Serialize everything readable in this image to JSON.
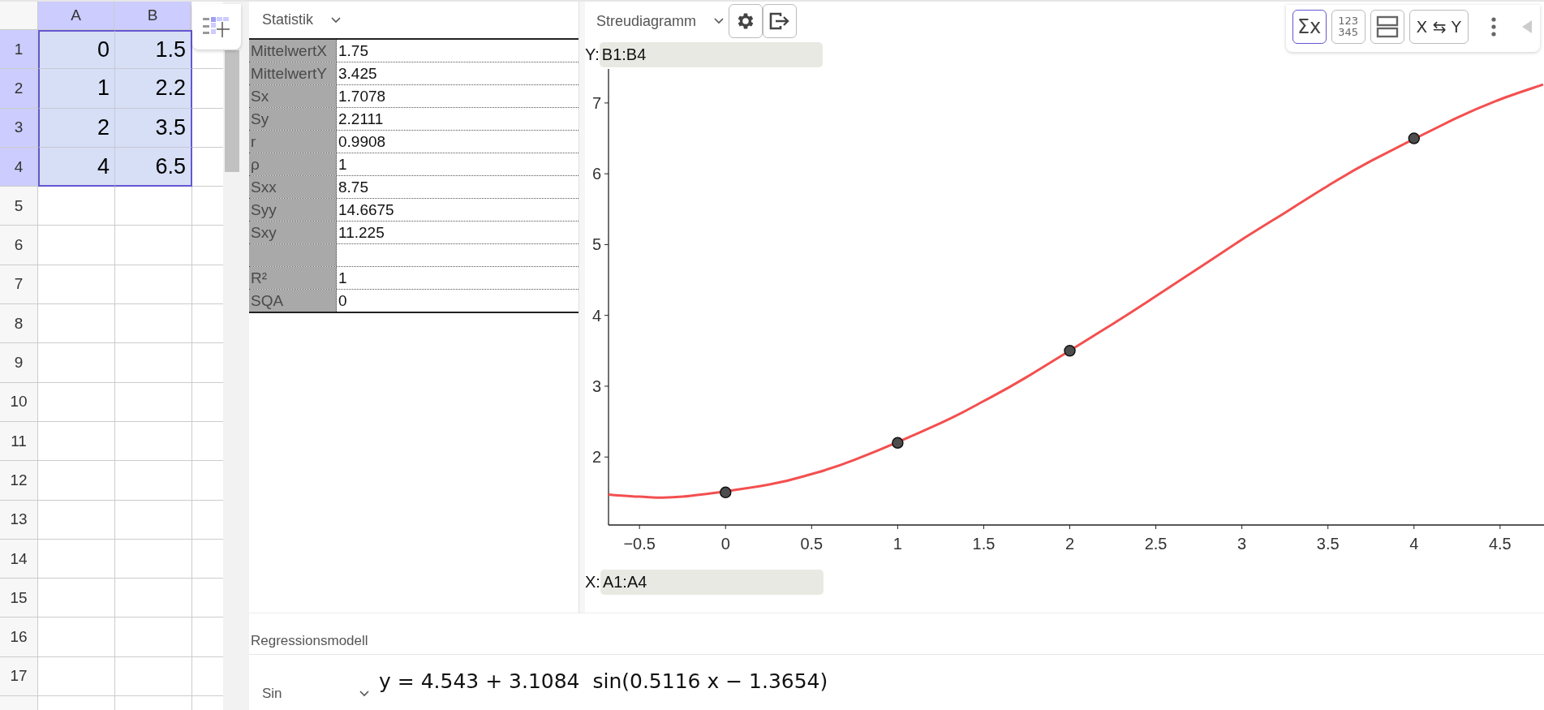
{
  "spreadsheet": {
    "columns": [
      {
        "label": "A",
        "selected": true
      },
      {
        "label": "B",
        "selected": true
      }
    ],
    "rows": [
      {
        "label": "1",
        "selected": true,
        "cells": [
          "0",
          "1.5"
        ]
      },
      {
        "label": "2",
        "selected": true,
        "cells": [
          "1",
          "2.2"
        ]
      },
      {
        "label": "3",
        "selected": true,
        "cells": [
          "2",
          "3.5"
        ]
      },
      {
        "label": "4",
        "selected": true,
        "cells": [
          "4",
          "6.5"
        ]
      },
      {
        "label": "5",
        "selected": false
      },
      {
        "label": "6",
        "selected": false
      },
      {
        "label": "7",
        "selected": false
      },
      {
        "label": "8",
        "selected": false
      },
      {
        "label": "9",
        "selected": false
      },
      {
        "label": "10",
        "selected": false
      },
      {
        "label": "11",
        "selected": false
      },
      {
        "label": "12",
        "selected": false
      },
      {
        "label": "13",
        "selected": false
      },
      {
        "label": "14",
        "selected": false
      },
      {
        "label": "15",
        "selected": false
      },
      {
        "label": "16",
        "selected": false
      },
      {
        "label": "17",
        "selected": false
      }
    ]
  },
  "statistics": {
    "dropdown": "Statistik",
    "rows": [
      {
        "kind": "stat",
        "label": "MittelwertX",
        "value": "1.75"
      },
      {
        "kind": "stat",
        "label": "MittelwertY",
        "value": "3.425"
      },
      {
        "kind": "stat",
        "label": "Sx",
        "value": "1.7078"
      },
      {
        "kind": "stat",
        "label": "Sy",
        "value": "2.2111"
      },
      {
        "kind": "stat",
        "label": "r",
        "value": "0.9908"
      },
      {
        "kind": "stat",
        "label": "ρ",
        "value": "1"
      },
      {
        "kind": "stat",
        "label": "Sxx",
        "value": "8.75"
      },
      {
        "kind": "stat",
        "label": "Syy",
        "value": "14.6675"
      },
      {
        "kind": "stat",
        "label": "Sxy",
        "value": "11.225"
      },
      {
        "kind": "blank"
      },
      {
        "kind": "stat",
        "label": "R²",
        "value": "1"
      },
      {
        "kind": "stat",
        "label": "SQA",
        "value": "0"
      }
    ]
  },
  "plot": {
    "dropdown": "Streudiagramm",
    "y_field": {
      "label": "Y:",
      "value": "B1:B4"
    },
    "x_field": {
      "label": "X:",
      "value": "A1:A4"
    },
    "toolbar": [
      {
        "kind": "sum",
        "label": "Σx",
        "selected": true
      },
      {
        "kind": "digits",
        "lines": [
          "123",
          "345"
        ],
        "selected": false
      },
      {
        "kind": "layout",
        "selected": false
      },
      {
        "kind": "swap",
        "label": "X ⇆ Y",
        "selected": false
      }
    ],
    "chart_data": {
      "type": "scatter",
      "xlim": [
        -0.68,
        4.76
      ],
      "ylim": [
        1.04,
        7.48
      ],
      "xticks": [
        {
          "value": -0.5,
          "label": "−0.5"
        },
        0,
        0.5,
        1,
        1.5,
        2,
        2.5,
        3,
        3.5,
        4,
        4.5
      ],
      "yticks": [
        2,
        3,
        4,
        5,
        6,
        7
      ],
      "series": [
        {
          "type": "scatter",
          "color": "#4d4d4d",
          "x": [
            0,
            1,
            2,
            4
          ],
          "values": [
            1.5,
            2.2,
            3.5,
            6.5
          ]
        },
        {
          "type": "line",
          "color": "#f44f4f",
          "x": [
            -0.68,
            -0.5,
            -0.25,
            0.25,
            0.5,
            0.75,
            1.25,
            1.5,
            1.75,
            2.25,
            2.5,
            2.75,
            3,
            3.25,
            3.5,
            3.75,
            4.25,
            4.5,
            4.75
          ],
          "values": [
            1.47,
            1.44,
            1.44,
            1.61,
            1.76,
            1.96,
            2.48,
            2.79,
            3.13,
            3.88,
            4.27,
            4.67,
            5.07,
            5.45,
            5.83,
            6.18,
            6.79,
            7.05,
            7.26
          ]
        }
      ]
    }
  },
  "regression": {
    "title": "Regressionsmodell",
    "model": "Sin",
    "equation": "y = 4.543 + 3.1084  sin(0.5116 x − 1.3654)"
  }
}
